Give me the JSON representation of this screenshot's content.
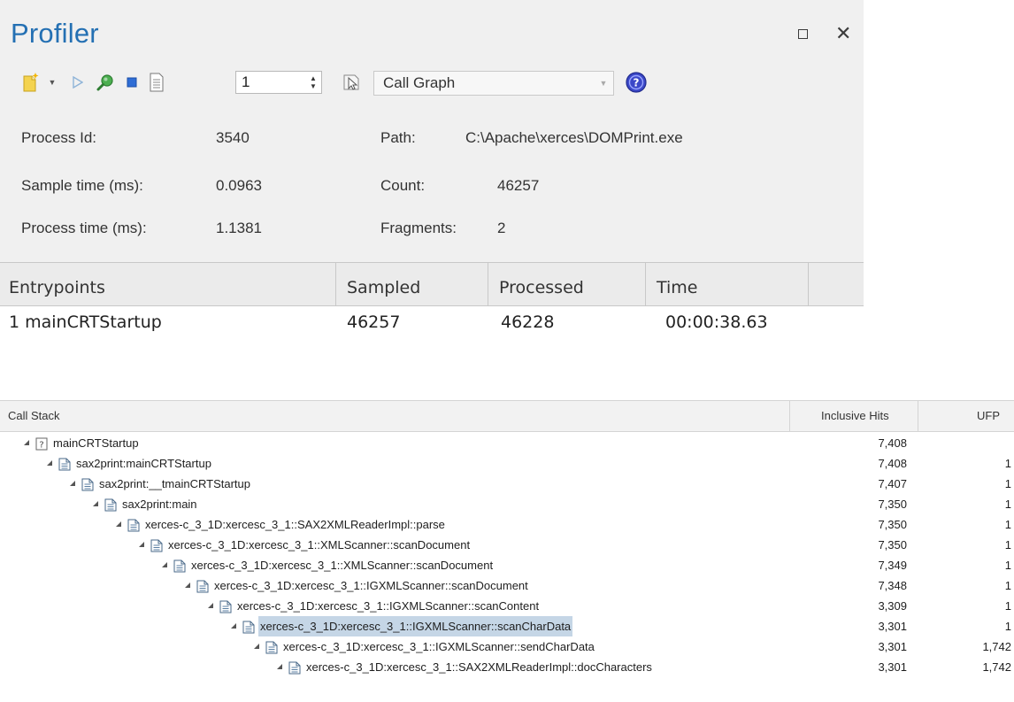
{
  "profiler": {
    "title": "Profiler",
    "toolbar": {
      "spinner_value": "1",
      "report_type": "Call Graph"
    },
    "info": {
      "process_id_label": "Process Id:",
      "process_id": "3540",
      "sample_time_label": "Sample time (ms):",
      "sample_time": "0.0963",
      "process_time_label": "Process time (ms):",
      "process_time": "1.1381",
      "path_label": "Path:",
      "path": "C:\\Apache\\xerces\\DOMPrint.exe",
      "count_label": "Count:",
      "count": "46257",
      "fragments_label": "Fragments:",
      "fragments": "2"
    },
    "entry_columns": [
      "Entrypoints",
      "Sampled",
      "Processed",
      "Time"
    ],
    "entries": [
      {
        "name": "1 mainCRTStartup",
        "sampled": "46257",
        "processed": "46228",
        "time": "00:00:38.63"
      }
    ]
  },
  "callstack": {
    "columns": [
      "Call Stack",
      "Inclusive Hits",
      "UFP"
    ],
    "rows": [
      {
        "depth": 0,
        "icon": "unknown-icon",
        "label": "mainCRTStartup",
        "hits": "7,408",
        "ufp": ""
      },
      {
        "depth": 1,
        "icon": "file-icon",
        "label": "sax2print:mainCRTStartup",
        "hits": "7,408",
        "ufp": "1"
      },
      {
        "depth": 2,
        "icon": "file-icon",
        "label": "sax2print:__tmainCRTStartup",
        "hits": "7,407",
        "ufp": "1"
      },
      {
        "depth": 3,
        "icon": "file-icon",
        "label": "sax2print:main",
        "hits": "7,350",
        "ufp": "1"
      },
      {
        "depth": 4,
        "icon": "file-icon",
        "label": "xerces-c_3_1D:xercesc_3_1::SAX2XMLReaderImpl::parse",
        "hits": "7,350",
        "ufp": "1"
      },
      {
        "depth": 5,
        "icon": "file-icon",
        "label": "xerces-c_3_1D:xercesc_3_1::XMLScanner::scanDocument",
        "hits": "7,350",
        "ufp": "1"
      },
      {
        "depth": 6,
        "icon": "file-icon",
        "label": "xerces-c_3_1D:xercesc_3_1::XMLScanner::scanDocument",
        "hits": "7,349",
        "ufp": "1"
      },
      {
        "depth": 7,
        "icon": "file-icon",
        "label": "xerces-c_3_1D:xercesc_3_1::IGXMLScanner::scanDocument",
        "hits": "7,348",
        "ufp": "1"
      },
      {
        "depth": 8,
        "icon": "file-icon",
        "label": "xerces-c_3_1D:xercesc_3_1::IGXMLScanner::scanContent",
        "hits": "3,309",
        "ufp": "1"
      },
      {
        "depth": 9,
        "icon": "file-icon",
        "label": "xerces-c_3_1D:xercesc_3_1::IGXMLScanner::scanCharData",
        "hits": "3,301",
        "ufp": "1",
        "selected": true
      },
      {
        "depth": 10,
        "icon": "file-icon",
        "label": "xerces-c_3_1D:xercesc_3_1::IGXMLScanner::sendCharData",
        "hits": "3,301",
        "ufp": "1,742"
      },
      {
        "depth": 11,
        "icon": "file-icon",
        "label": "xerces-c_3_1D:xercesc_3_1::SAX2XMLReaderImpl::docCharacters",
        "hits": "3,301",
        "ufp": "1,742"
      }
    ]
  },
  "colors": {
    "title_blue": "#2470b3",
    "selection": "#c5d6e6",
    "panel_bg": "#f0f0f0"
  }
}
